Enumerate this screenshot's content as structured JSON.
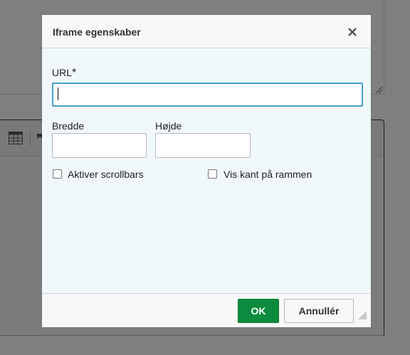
{
  "dialog": {
    "title": "Iframe egenskaber",
    "url": {
      "label": "URL",
      "required_mark": "*",
      "value": ""
    },
    "width": {
      "label": "Bredde",
      "value": ""
    },
    "height": {
      "label": "Højde",
      "value": ""
    },
    "scrollbars": {
      "label": "Aktiver scrollbars",
      "checked": false
    },
    "frame_border": {
      "label": "Vis kant på rammen",
      "checked": false
    },
    "buttons": {
      "ok": "OK",
      "cancel": "Annullér"
    }
  },
  "icons": {
    "close": "close-icon",
    "table": "table-icon",
    "flag": "flag-icon",
    "resize": "resize-handle-icon"
  },
  "colors": {
    "ok_button": "#0c8b3e",
    "focus_border": "#47a0c8",
    "dialog_body": "#f0f8fc",
    "overlay": "#7f7f7f"
  }
}
